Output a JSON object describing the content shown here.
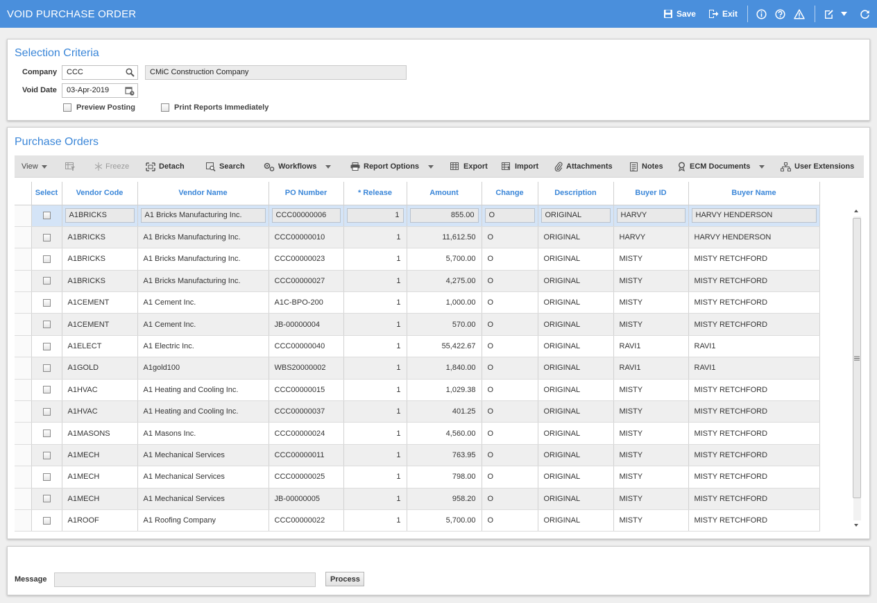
{
  "window": {
    "title": "VOID PURCHASE ORDER",
    "save_label": "Save",
    "exit_label": "Exit"
  },
  "selection": {
    "title": "Selection Criteria",
    "company_label": "Company",
    "company_value": "CCC",
    "company_name": "CMiC Construction Company",
    "void_date_label": "Void Date",
    "void_date_value": "03-Apr-2019",
    "preview_posting_label": "Preview Posting",
    "print_reports_label": "Print Reports Immediately"
  },
  "po": {
    "title": "Purchase Orders",
    "toolbar": {
      "view": "View",
      "freeze": "Freeze",
      "detach": "Detach",
      "search": "Search",
      "workflows": "Workflows",
      "report_options": "Report Options",
      "export": "Export",
      "import": "Import",
      "attachments": "Attachments",
      "notes": "Notes",
      "ecm_documents": "ECM Documents",
      "user_extensions": "User Extensions"
    },
    "columns": {
      "select": "Select",
      "vendor_code": "Vendor Code",
      "vendor_name": "Vendor Name",
      "po_number": "PO Number",
      "release": "* Release",
      "amount": "Amount",
      "change": "Change",
      "description": "Description",
      "buyer_id": "Buyer ID",
      "buyer_name": "Buyer Name"
    },
    "rows": [
      {
        "vendor_code": "A1BRICKS",
        "vendor_name": "A1 Bricks Manufacturing Inc.",
        "po_number": "CCC00000006",
        "release": "1",
        "amount": "855.00",
        "change": "O",
        "description": "ORIGINAL",
        "buyer_id": "HARVY",
        "buyer_name": "HARVY HENDERSON"
      },
      {
        "vendor_code": "A1BRICKS",
        "vendor_name": "A1 Bricks Manufacturing Inc.",
        "po_number": "CCC00000010",
        "release": "1",
        "amount": "11,612.50",
        "change": "O",
        "description": "ORIGINAL",
        "buyer_id": "HARVY",
        "buyer_name": "HARVY HENDERSON"
      },
      {
        "vendor_code": "A1BRICKS",
        "vendor_name": "A1 Bricks Manufacturing Inc.",
        "po_number": "CCC00000023",
        "release": "1",
        "amount": "5,700.00",
        "change": "O",
        "description": "ORIGINAL",
        "buyer_id": "MISTY",
        "buyer_name": "MISTY RETCHFORD"
      },
      {
        "vendor_code": "A1BRICKS",
        "vendor_name": "A1 Bricks Manufacturing Inc.",
        "po_number": "CCC00000027",
        "release": "1",
        "amount": "4,275.00",
        "change": "O",
        "description": "ORIGINAL",
        "buyer_id": "MISTY",
        "buyer_name": "MISTY RETCHFORD"
      },
      {
        "vendor_code": "A1CEMENT",
        "vendor_name": "A1 Cement Inc.",
        "po_number": "A1C-BPO-200",
        "release": "1",
        "amount": "1,000.00",
        "change": "O",
        "description": "ORIGINAL",
        "buyer_id": "MISTY",
        "buyer_name": "MISTY RETCHFORD"
      },
      {
        "vendor_code": "A1CEMENT",
        "vendor_name": "A1 Cement Inc.",
        "po_number": "JB-00000004",
        "release": "1",
        "amount": "570.00",
        "change": "O",
        "description": "ORIGINAL",
        "buyer_id": "MISTY",
        "buyer_name": "MISTY RETCHFORD"
      },
      {
        "vendor_code": "A1ELECT",
        "vendor_name": "A1 Electric Inc.",
        "po_number": "CCC00000040",
        "release": "1",
        "amount": "55,422.67",
        "change": "O",
        "description": "ORIGINAL",
        "buyer_id": "RAVI1",
        "buyer_name": "RAVI1"
      },
      {
        "vendor_code": "A1GOLD",
        "vendor_name": "A1gold100",
        "po_number": "WBS20000002",
        "release": "1",
        "amount": "1,840.00",
        "change": "O",
        "description": "ORIGINAL",
        "buyer_id": "RAVI1",
        "buyer_name": "RAVI1"
      },
      {
        "vendor_code": "A1HVAC",
        "vendor_name": "A1 Heating and Cooling Inc.",
        "po_number": "CCC00000015",
        "release": "1",
        "amount": "1,029.38",
        "change": "O",
        "description": "ORIGINAL",
        "buyer_id": "MISTY",
        "buyer_name": "MISTY RETCHFORD"
      },
      {
        "vendor_code": "A1HVAC",
        "vendor_name": "A1 Heating and Cooling Inc.",
        "po_number": "CCC00000037",
        "release": "1",
        "amount": "401.25",
        "change": "O",
        "description": "ORIGINAL",
        "buyer_id": "MISTY",
        "buyer_name": "MISTY RETCHFORD"
      },
      {
        "vendor_code": "A1MASONS",
        "vendor_name": "A1 Masons Inc.",
        "po_number": "CCC00000024",
        "release": "1",
        "amount": "4,560.00",
        "change": "O",
        "description": "ORIGINAL",
        "buyer_id": "MISTY",
        "buyer_name": "MISTY RETCHFORD"
      },
      {
        "vendor_code": "A1MECH",
        "vendor_name": "A1 Mechanical Services",
        "po_number": "CCC00000011",
        "release": "1",
        "amount": "763.95",
        "change": "O",
        "description": "ORIGINAL",
        "buyer_id": "MISTY",
        "buyer_name": "MISTY RETCHFORD"
      },
      {
        "vendor_code": "A1MECH",
        "vendor_name": "A1 Mechanical Services",
        "po_number": "CCC00000025",
        "release": "1",
        "amount": "798.00",
        "change": "O",
        "description": "ORIGINAL",
        "buyer_id": "MISTY",
        "buyer_name": "MISTY RETCHFORD"
      },
      {
        "vendor_code": "A1MECH",
        "vendor_name": "A1 Mechanical Services",
        "po_number": "JB-00000005",
        "release": "1",
        "amount": "958.20",
        "change": "O",
        "description": "ORIGINAL",
        "buyer_id": "MISTY",
        "buyer_name": "MISTY RETCHFORD"
      },
      {
        "vendor_code": "A1ROOF",
        "vendor_name": "A1 Roofing Company",
        "po_number": "CCC00000022",
        "release": "1",
        "amount": "5,700.00",
        "change": "O",
        "description": "ORIGINAL",
        "buyer_id": "MISTY",
        "buyer_name": "MISTY RETCHFORD"
      }
    ]
  },
  "footer": {
    "message_label": "Message",
    "message_value": "",
    "process_label": "Process"
  },
  "colors": {
    "title_bar": "#4a8fdc",
    "section_title": "#3a86d8",
    "selected_row": "#d4e4f7"
  }
}
